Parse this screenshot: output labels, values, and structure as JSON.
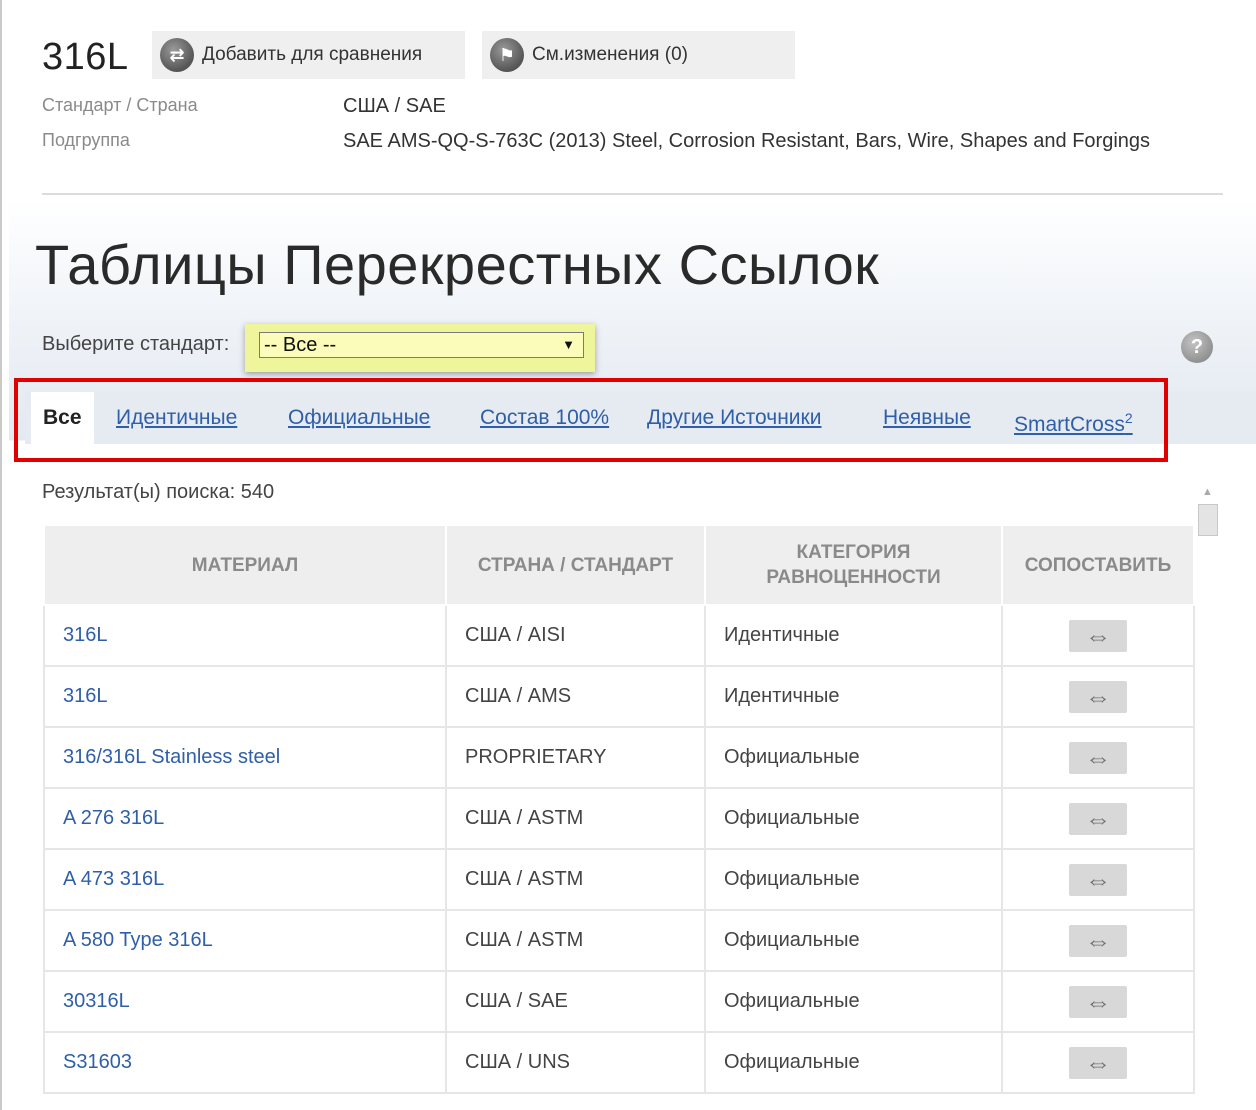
{
  "material": {
    "title": "316L",
    "compare_btn": "Добавить для сравнения",
    "changes_btn": "См.изменения (0)",
    "info": [
      {
        "label": "Стандарт / Страна",
        "value": "США / SAE"
      },
      {
        "label": "Подгруппа",
        "value": "SAE AMS-QQ-S-763C (2013) Steel, Corrosion Resistant, Bars, Wire, Shapes and Forgings"
      }
    ]
  },
  "section": {
    "title": "Таблицы Перекрестных Ссылок",
    "standard_label": "Выберите стандарт:",
    "standard_value": "-- Все --",
    "help": "?"
  },
  "tabs": [
    {
      "label": "Все",
      "active": true
    },
    {
      "label": "Идентичные"
    },
    {
      "label": "Официальные"
    },
    {
      "label": "Состав 100%"
    },
    {
      "label": "Другие Источники"
    },
    {
      "label": "Неявные"
    },
    {
      "label": "SmartCross",
      "sup": "2"
    }
  ],
  "results": "Результат(ы) поиска: 540",
  "table": {
    "headers": [
      "МАТЕРИАЛ",
      "СТРАНА / СТАНДАРТ",
      "КАТЕГОРИЯ РАВНОЦЕННОСТИ",
      "СОПОСТАВИТЬ"
    ],
    "rows": [
      {
        "material": "316L",
        "country": "США / AISI",
        "category": "Идентичные"
      },
      {
        "material": "316L",
        "country": "США / AMS",
        "category": "Идентичные"
      },
      {
        "material": "316/316L Stainless steel",
        "country": "PROPRIETARY",
        "category": "Официальные"
      },
      {
        "material": "A 276 316L",
        "country": "США / ASTM",
        "category": "Официальные"
      },
      {
        "material": "A 473 316L",
        "country": "США / ASTM",
        "category": "Официальные"
      },
      {
        "material": "A 580 Type 316L",
        "country": "США / ASTM",
        "category": "Официальные"
      },
      {
        "material": "30316L",
        "country": "США / SAE",
        "category": "Официальные"
      },
      {
        "material": "S31603",
        "country": "США / UNS",
        "category": "Официальные"
      }
    ]
  },
  "icons": {
    "compare": "compare-arrows-icon",
    "changes": "flag-icon",
    "swap": "swap-arrows-icon"
  }
}
